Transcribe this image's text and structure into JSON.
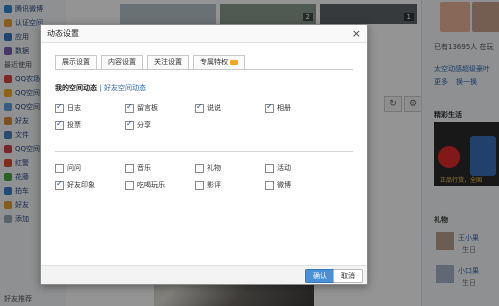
{
  "sidebar": {
    "items": [
      {
        "label": "腾讯微博",
        "color": "#2a8ad8"
      },
      {
        "label": "认证空间",
        "color": "#f0a030"
      },
      {
        "label": "应用",
        "color": "#3a74c4"
      },
      {
        "label": "数据",
        "color": "#7a5fb0"
      }
    ],
    "section_title": "最近使用",
    "recent": [
      {
        "label": "QQ农场",
        "color": "#e04040"
      },
      {
        "label": "QQ空间",
        "color": "#f0b020"
      },
      {
        "label": "QQ空间",
        "color": "#58a0e0"
      },
      {
        "label": "好友",
        "color": "#e08a30"
      },
      {
        "label": "文件",
        "color": "#4a80c0"
      },
      {
        "label": "QQ空间",
        "color": "#d04040"
      },
      {
        "label": "红警",
        "color": "#e04a30"
      },
      {
        "label": "花藤",
        "color": "#48a848"
      },
      {
        "label": "拍车",
        "color": "#3a80d0"
      },
      {
        "label": "好友",
        "color": "#e0a030"
      },
      {
        "label": "添加",
        "color": "#9aa7b6"
      }
    ],
    "bottom_title": "好友推荐"
  },
  "feed": {
    "thumb_badges": [
      "2",
      "2",
      "1"
    ],
    "refresh_icon": "refresh-icon",
    "settings_icon": "gear-icon"
  },
  "rail": {
    "visitor_text": "已有13695人 在玩",
    "link_line": "太空动感超级豪叶",
    "more": "更多",
    "swap": "换一换",
    "life_title": "精彩生活",
    "ad_text": "正品行货，全国",
    "gift_title": "礼物",
    "friend1": "王小果",
    "friend1_sub": "生日",
    "friend2": "小口果",
    "friend2_sub": "生日"
  },
  "dialog": {
    "title": "动态设置",
    "close_label": "×",
    "tabs": [
      "展示设置",
      "内容设置",
      "关注设置",
      "专属特权"
    ],
    "section_title": "我的空间动态",
    "section_link": "| 好友空间动态",
    "checks_top": [
      {
        "label": "日志",
        "checked": true
      },
      {
        "label": "留言板",
        "checked": true
      },
      {
        "label": "说说",
        "checked": true
      },
      {
        "label": "相册",
        "checked": true
      },
      {
        "label": "投票",
        "checked": true
      },
      {
        "label": "分享",
        "checked": true
      }
    ],
    "checks_bottom": [
      {
        "label": "问问",
        "checked": false
      },
      {
        "label": "音乐",
        "checked": false
      },
      {
        "label": "礼物",
        "checked": false
      },
      {
        "label": "活动",
        "checked": false
      },
      {
        "label": "好友印象",
        "checked": true
      },
      {
        "label": "吃喝玩乐",
        "checked": false
      },
      {
        "label": "影评",
        "checked": false
      },
      {
        "label": "微博",
        "checked": false
      }
    ],
    "ok_label": "确认",
    "cancel_label": "取消"
  }
}
